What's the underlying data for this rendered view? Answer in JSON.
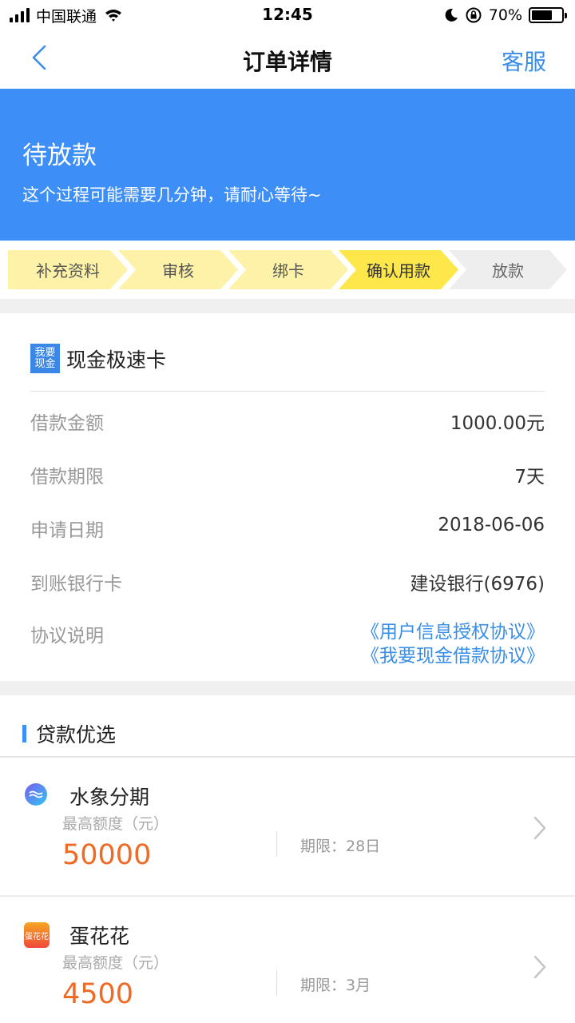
{
  "status_bar": {
    "carrier": "中国联通",
    "time": "12:45",
    "battery": "70%",
    "battery_level": 0.7
  },
  "nav": {
    "title": "订单详情",
    "service_label": "客服"
  },
  "banner": {
    "status": "待放款",
    "message": "这个过程可能需要几分钟，请耐心等待~"
  },
  "steps": [
    {
      "label": "补充资料",
      "state": "done"
    },
    {
      "label": "审核",
      "state": "done"
    },
    {
      "label": "绑卡",
      "state": "done"
    },
    {
      "label": "确认用款",
      "state": "current"
    },
    {
      "label": "放款",
      "state": "pending"
    }
  ],
  "order": {
    "logo_line1": "我要",
    "logo_line2": "现金",
    "product_name": "现金极速卡",
    "rows": [
      {
        "label": "借款金额",
        "value": "1000.00元"
      },
      {
        "label": "借款期限",
        "value": "7天"
      },
      {
        "label": "申请日期",
        "value": "2018-06-06"
      },
      {
        "label": "到账银行卡",
        "value": "建设银行(6976)"
      }
    ],
    "agreement_label": "协议说明",
    "agreements": [
      "《用户信息授权协议》",
      "《我要现金借款协议》"
    ]
  },
  "recommend": {
    "title": "贷款优选",
    "items": [
      {
        "name": "水象分期",
        "limit_label": "最高额度（元）",
        "amount": "50000",
        "term": "期限：28日",
        "icon": "water-wave-icon"
      },
      {
        "name": "蛋花花",
        "limit_label": "最高额度（元）",
        "amount": "4500",
        "term": "期限：3月",
        "icon": "danhuahua-logo-icon",
        "icon_text": "蛋花花"
      }
    ]
  },
  "colors": {
    "primary": "#3d8ef7",
    "link": "#3a8ee6",
    "amount": "#ee6a25",
    "step_done": "#fdf2a7",
    "step_current": "#fde74b",
    "step_pending": "#eeeeee"
  }
}
